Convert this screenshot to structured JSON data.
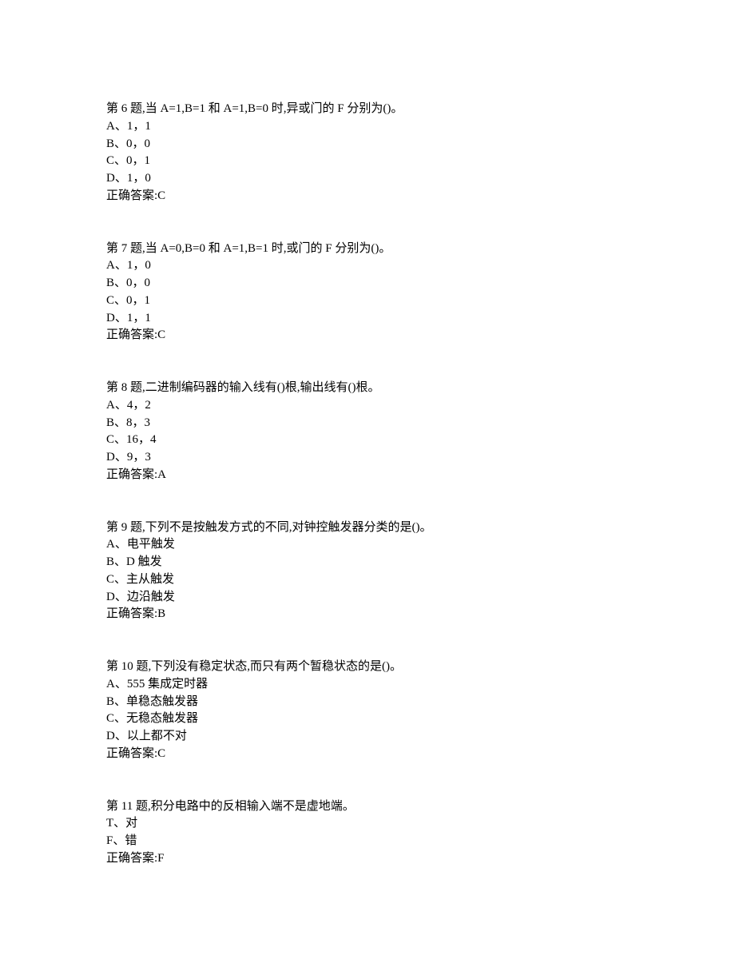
{
  "questions": [
    {
      "stem": "第 6 题,当 A=1,B=1 和 A=1,B=0 时,异或门的 F 分别为()。",
      "options": [
        "A、1，1",
        "B、0，0",
        "C、0，1",
        "D、1，0"
      ],
      "answer": "正确答案:C"
    },
    {
      "stem": "第 7 题,当 A=0,B=0 和 A=1,B=1 时,或门的 F 分别为()。",
      "options": [
        "A、1，0",
        "B、0，0",
        "C、0，1",
        "D、1，1"
      ],
      "answer": "正确答案:C"
    },
    {
      "stem": "第 8 题,二进制编码器的输入线有()根,输出线有()根。",
      "options": [
        "A、4，2",
        "B、8，3",
        "C、16，4",
        "D、9，3"
      ],
      "answer": "正确答案:A"
    },
    {
      "stem": "第 9 题,下列不是按触发方式的不同,对钟控触发器分类的是()。",
      "options": [
        "A、电平触发",
        "B、D 触发",
        "C、主从触发",
        "D、边沿触发"
      ],
      "answer": "正确答案:B"
    },
    {
      "stem": "第 10 题,下列没有稳定状态,而只有两个暂稳状态的是()。",
      "options": [
        "A、555 集成定时器",
        "B、单稳态触发器",
        "C、无稳态触发器",
        "D、以上都不对"
      ],
      "answer": "正确答案:C"
    },
    {
      "stem": "第 11 题,积分电路中的反相输入端不是虚地端。",
      "options": [
        "T、对",
        "F、错"
      ],
      "answer": "正确答案:F"
    }
  ]
}
